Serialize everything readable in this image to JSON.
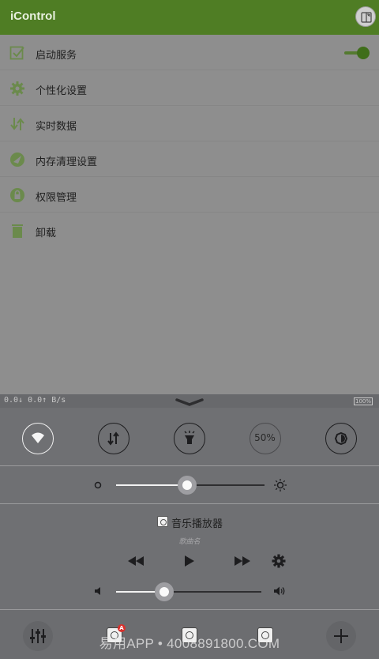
{
  "app": {
    "title": "iControl"
  },
  "settings": {
    "items": [
      {
        "label": "启动服务",
        "icon": "checkbox-icon"
      },
      {
        "label": "个性化设置",
        "icon": "gear-icon"
      },
      {
        "label": "实时数据",
        "icon": "updown-arrows-icon"
      },
      {
        "label": "内存清理设置",
        "icon": "broom-icon"
      },
      {
        "label": "权限管理",
        "icon": "lock-icon"
      },
      {
        "label": "卸载",
        "icon": "trash-icon"
      }
    ],
    "service_toggle_on": true
  },
  "panel": {
    "net_speed": "0.0↓ 0.0↑ B/s",
    "battery": "100%",
    "brightness_percent_label": "50%",
    "quick_toggles": [
      {
        "name": "wifi",
        "active": true
      },
      {
        "name": "mobile-data",
        "active": false
      },
      {
        "name": "flashlight",
        "active": false
      },
      {
        "name": "brightness-percent",
        "active": false
      },
      {
        "name": "auto-brightness",
        "active": false
      }
    ],
    "brightness_level": 0.48,
    "player": {
      "title": "音乐播放器",
      "song": "歌曲名"
    },
    "volume_level": 0.33,
    "dock": {
      "badge": "A",
      "watermark": "易用APP • 4008891800.COM"
    }
  },
  "colors": {
    "appbar": "#4f7d24",
    "accent": "#547a30",
    "overlay_panel": "#6f7073"
  }
}
